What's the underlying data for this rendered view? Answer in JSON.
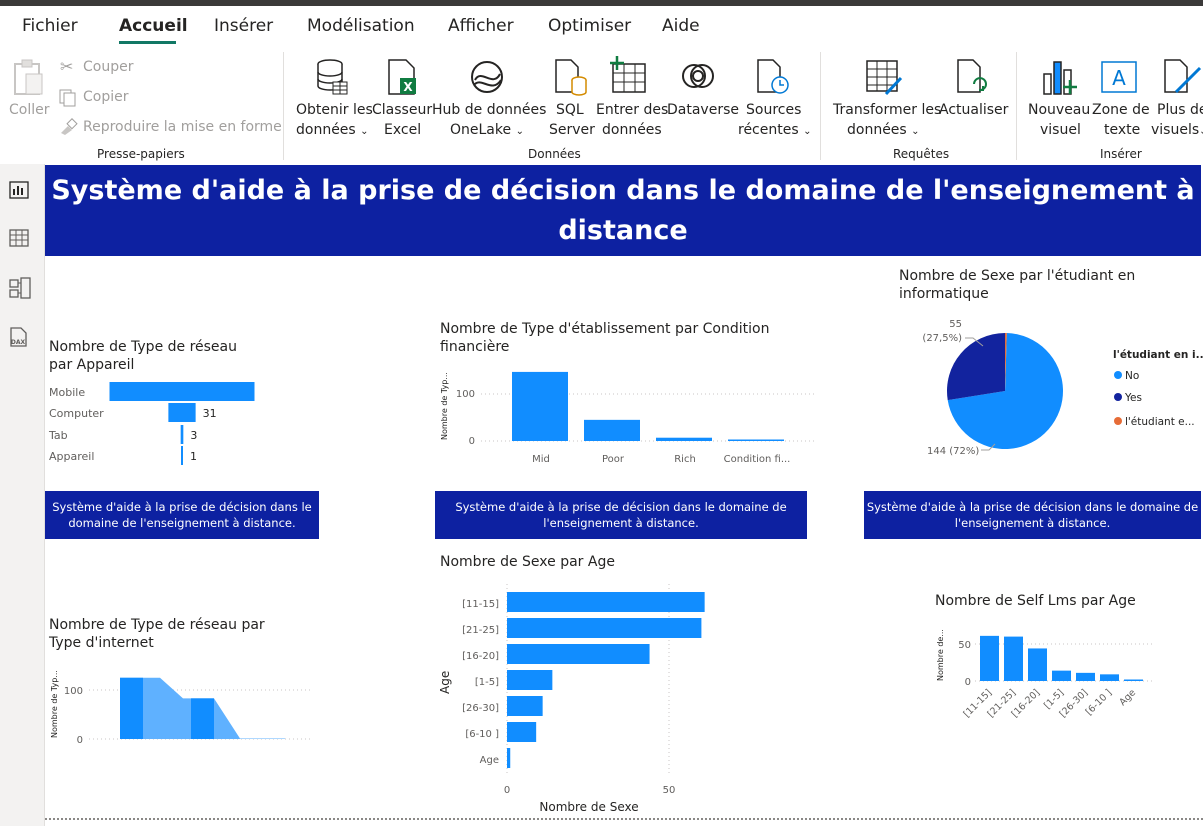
{
  "menu": {
    "items": [
      "Fichier",
      "Accueil",
      "Insérer",
      "Modélisation",
      "Afficher",
      "Optimiser",
      "Aide"
    ],
    "active": "Accueil"
  },
  "ribbon": {
    "clipboard": {
      "paste": "Coller",
      "cut": "Couper",
      "copy": "Copier",
      "format_painter": "Reproduire la mise en forme",
      "group_label": "Presse-papiers"
    },
    "data": {
      "get_data_1": "Obtenir les",
      "get_data_2": "données",
      "excel_1": "Classeur",
      "excel_2": "Excel",
      "onelake_1": "Hub de données",
      "onelake_2": "OneLake",
      "sql_1": "SQL",
      "sql_2": "Server",
      "enter_1": "Entrer des",
      "enter_2": "données",
      "dataverse": "Dataverse",
      "recent_1": "Sources",
      "recent_2": "récentes",
      "group_label": "Données"
    },
    "queries": {
      "transform_1": "Transformer les",
      "transform_2": "données",
      "refresh": "Actualiser",
      "group_label": "Requêtes"
    },
    "insert": {
      "new_visual_1": "Nouveau",
      "new_visual_2": "visuel",
      "textbox_1": "Zone de",
      "textbox_2": "texte",
      "more_1": "Plus de",
      "more_2": "visuels",
      "group_label": "Insérer"
    }
  },
  "report": {
    "banner_title": "Système d'aide à la prise de décision dans le domaine de l'enseignement à distance",
    "caption": "Système d'aide à la prise de décision dans le domaine de l'enseignement à distance.",
    "visual1": {
      "title": "Nombre de Type de réseau par Appareil",
      "categories": [
        "Mobile",
        "Computer",
        "Tab",
        "Appareil"
      ],
      "value_labels": [
        "",
        "31",
        "3",
        "1"
      ]
    },
    "visual2": {
      "title": "Nombre de Type d'établissement par Condition financière",
      "ylabel": "Nombre de Typ...",
      "ticks": [
        "100",
        "0"
      ],
      "categories": [
        "Mid",
        "Poor",
        "Rich",
        "Condition fi..."
      ]
    },
    "visual3": {
      "title": "Nombre de Sexe par l'étudiant en informatique",
      "label_yes_count": "55",
      "label_yes_pct": "(27,5%)",
      "label_no": "144 (72%)",
      "legend_title": "l'étudiant en i...",
      "legend": [
        "No",
        "Yes",
        "l'étudiant e..."
      ]
    },
    "visual4": {
      "title": "Nombre de Type de réseau par Type d'internet",
      "ylabel": "Nombre de Typ...",
      "ticks": [
        "100",
        "0"
      ]
    },
    "visual5": {
      "title": "Nombre de Sexe par Age",
      "ylabel": "Age",
      "xlabel": "Nombre de Sexe",
      "categories": [
        "[11-15]",
        "[21-25]",
        "[16-20]",
        "[1-5]",
        "[26-30]",
        "[6-10 ]",
        "Age"
      ],
      "xticks": [
        "0",
        "50"
      ]
    },
    "visual6": {
      "title": "Nombre de Self Lms par Age",
      "ylabel": "Nombre de...",
      "ticks": [
        "50",
        "0"
      ],
      "categories": [
        "[11-15]",
        "[21-25]",
        "[16-20]",
        "[1-5]",
        "[26-30]",
        "[6-10 ]",
        "Age"
      ]
    }
  },
  "colors": {
    "accent_blue": "#118dff",
    "dark_blue": "#12239e",
    "orange": "#e66c37",
    "banner": "#0d21a1",
    "area_light": "#5fb1ff"
  },
  "chart_data": [
    {
      "type": "bar",
      "title": "Nombre de Type de réseau par Appareil",
      "categories": [
        "Mobile",
        "Computer",
        "Tab",
        "Appareil"
      ],
      "values": [
        165,
        31,
        3,
        1
      ]
    },
    {
      "type": "bar",
      "title": "Nombre de Type d'établissement par Condition financière",
      "categories": [
        "Mid",
        "Poor",
        "Rich",
        "Condition fi..."
      ],
      "values": [
        147,
        45,
        7,
        1
      ],
      "ylim": [
        0,
        150
      ]
    },
    {
      "type": "pie",
      "title": "Nombre de Sexe par l'étudiant en informatique",
      "categories": [
        "No",
        "Yes",
        "l'étudiant e..."
      ],
      "values": [
        144,
        55,
        1
      ]
    },
    {
      "type": "area",
      "title": "Nombre de Type de réseau par Type d'internet",
      "values": [
        125,
        125,
        125,
        83,
        83,
        83,
        1,
        1
      ],
      "ylim": [
        0,
        150
      ]
    },
    {
      "type": "bar",
      "title": "Nombre de Sexe par Age",
      "categories": [
        "[11-15]",
        "[21-25]",
        "[16-20]",
        "[1-5]",
        "[26-30]",
        "[6-10 ]",
        "Age"
      ],
      "values": [
        61,
        60,
        44,
        14,
        11,
        9,
        1
      ],
      "xlabel": "Nombre de Sexe",
      "ylabel": "Age"
    },
    {
      "type": "bar",
      "title": "Nombre de Self Lms par Age",
      "categories": [
        "[11-15]",
        "[21-25]",
        "[16-20]",
        "[1-5]",
        "[26-30]",
        "[6-10 ]",
        "Age"
      ],
      "values": [
        61,
        60,
        44,
        14,
        11,
        9,
        1
      ]
    }
  ]
}
